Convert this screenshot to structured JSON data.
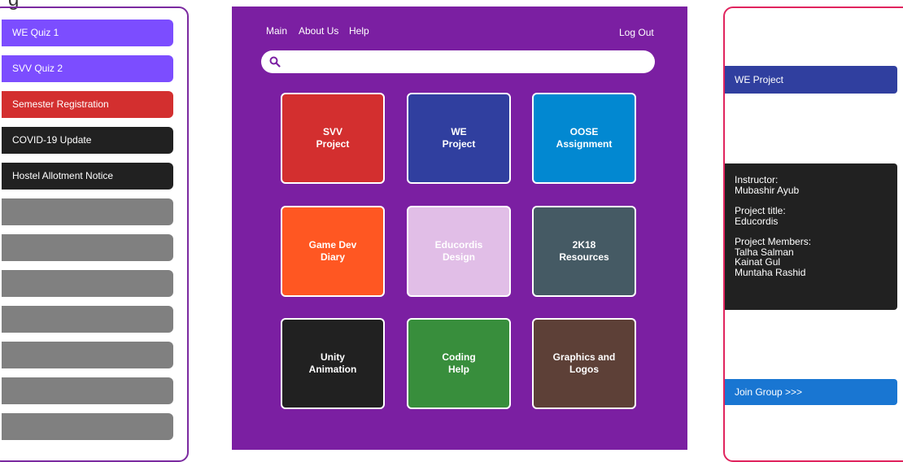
{
  "heading_fragment": "g",
  "left_panel": {
    "notices": [
      {
        "label": "WE Quiz 1",
        "color": "#7c4dff"
      },
      {
        "label": "SVV Quiz 2",
        "color": "#7c4dff"
      },
      {
        "label": "Semester Registration",
        "color": "#d32f2f"
      },
      {
        "label": "COVID-19 Update",
        "color": "#212121"
      },
      {
        "label": "Hostel Allotment Notice",
        "color": "#212121"
      }
    ],
    "empty_color": "#808080"
  },
  "nav": {
    "main": "Main",
    "about": "About Us",
    "help": "Help",
    "logout": "Log Out"
  },
  "search": {
    "icon": "search-icon",
    "placeholder": "",
    "value": ""
  },
  "tiles": [
    {
      "line1": "SVV",
      "line2": "Project",
      "color": "#d32f2f"
    },
    {
      "line1": "WE",
      "line2": "Project",
      "color": "#303f9f"
    },
    {
      "line1": "OOSE",
      "line2": "Assignment",
      "color": "#0288d1"
    },
    {
      "line1": "Game Dev",
      "line2": "Diary",
      "color": "#ff5722"
    },
    {
      "line1": "Educordis",
      "line2": "Design",
      "color": "#e1bee7"
    },
    {
      "line1": "2K18",
      "line2": "Resources",
      "color": "#455a64"
    },
    {
      "line1": "Unity",
      "line2": "Animation",
      "color": "#212121"
    },
    {
      "line1": "Coding",
      "line2": "Help",
      "color": "#388e3c"
    },
    {
      "line1": "Graphics and",
      "line2": "Logos",
      "color": "#5d4037"
    }
  ],
  "right_panel": {
    "project_label": "WE Project",
    "instructor_label": "Instructor:",
    "instructor": "Mubashir Ayub",
    "title_label": "Project title:",
    "title": "Educordis",
    "members_label": "Project Members:",
    "members": [
      "Talha Salman",
      "Kainat Gul",
      "Muntaha Rashid"
    ],
    "join_label": "Join Group >>>",
    "colors": {
      "project": "#303f9f",
      "info": "#212121",
      "join": "#1976d2"
    }
  }
}
